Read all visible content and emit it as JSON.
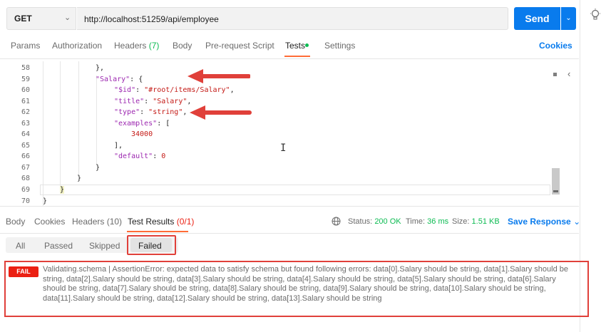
{
  "request": {
    "method": "GET",
    "url": "http://localhost:51259/api/employee",
    "send_label": "Send"
  },
  "request_tabs": {
    "params": "Params",
    "authorization": "Authorization",
    "headers": "Headers",
    "headers_count": "(7)",
    "body": "Body",
    "prerequest": "Pre-request Script",
    "tests": "Tests",
    "settings": "Settings",
    "cookies": "Cookies"
  },
  "code": {
    "line_numbers": [
      "58",
      "59",
      "60",
      "61",
      "62",
      "63",
      "64",
      "65",
      "66",
      "67",
      "68",
      "69",
      "70"
    ],
    "l58": "},",
    "l59_key": "\"Salary\"",
    "l59_rest": ": {",
    "l60_key": "\"$id\"",
    "l60_sep": ": ",
    "l60_val": "\"#root/items/Salary\"",
    "l60_end": ",",
    "l61_key": "\"title\"",
    "l61_sep": ": ",
    "l61_val": "\"Salary\"",
    "l61_end": ",",
    "l62_key": "\"type\"",
    "l62_sep": ": ",
    "l62_val": "\"string\"",
    "l62_end": ",",
    "l63_key": "\"examples\"",
    "l63_rest": ": [",
    "l64_val": "34000",
    "l65": "],",
    "l66_key": "\"default\"",
    "l66_sep": ": ",
    "l66_val": "0",
    "l67": "}",
    "l68": "}",
    "l69": "}",
    "l70": "}"
  },
  "response_tabs": {
    "body": "Body",
    "cookies": "Cookies",
    "headers": "Headers",
    "headers_count": "(10)",
    "test_results": "Test Results",
    "test_results_count": "(0/1)"
  },
  "status": {
    "status_label": "Status:",
    "status_value": "200 OK",
    "time_label": "Time:",
    "time_value": "36 ms",
    "size_label": "Size:",
    "size_value": "1.51 KB",
    "save_response": "Save Response"
  },
  "filters": {
    "all": "All",
    "passed": "Passed",
    "skipped": "Skipped",
    "failed": "Failed"
  },
  "result": {
    "badge": "FAIL",
    "message": "Validating.schema | AssertionError: expected data to satisfy schema but found following errors: data[0].Salary should be string, data[1].Salary should be string, data[2].Salary should be string, data[3].Salary should be string, data[4].Salary should be string, data[5].Salary should be string, data[6].Salary should be string, data[7].Salary should be string, data[8].Salary should be string, data[9].Salary should be string, data[10].Salary should be string, data[11].Salary should be string, data[12].Salary should be string, data[13].Salary should be string"
  },
  "colors": {
    "accent_blue": "#097bed",
    "tab_orange": "#ff6c37",
    "success_green": "#0cbb52",
    "fail_red": "#eb2013",
    "annotation_red": "#e0403a"
  },
  "icons": {
    "method_dropdown": "chevron-down-icon",
    "send_dropdown": "chevron-down-icon",
    "side_panel": "lightbulb-icon",
    "collapse": "chevron-left-icon",
    "network": "globe-icon",
    "save_dropdown": "chevron-down-icon"
  }
}
